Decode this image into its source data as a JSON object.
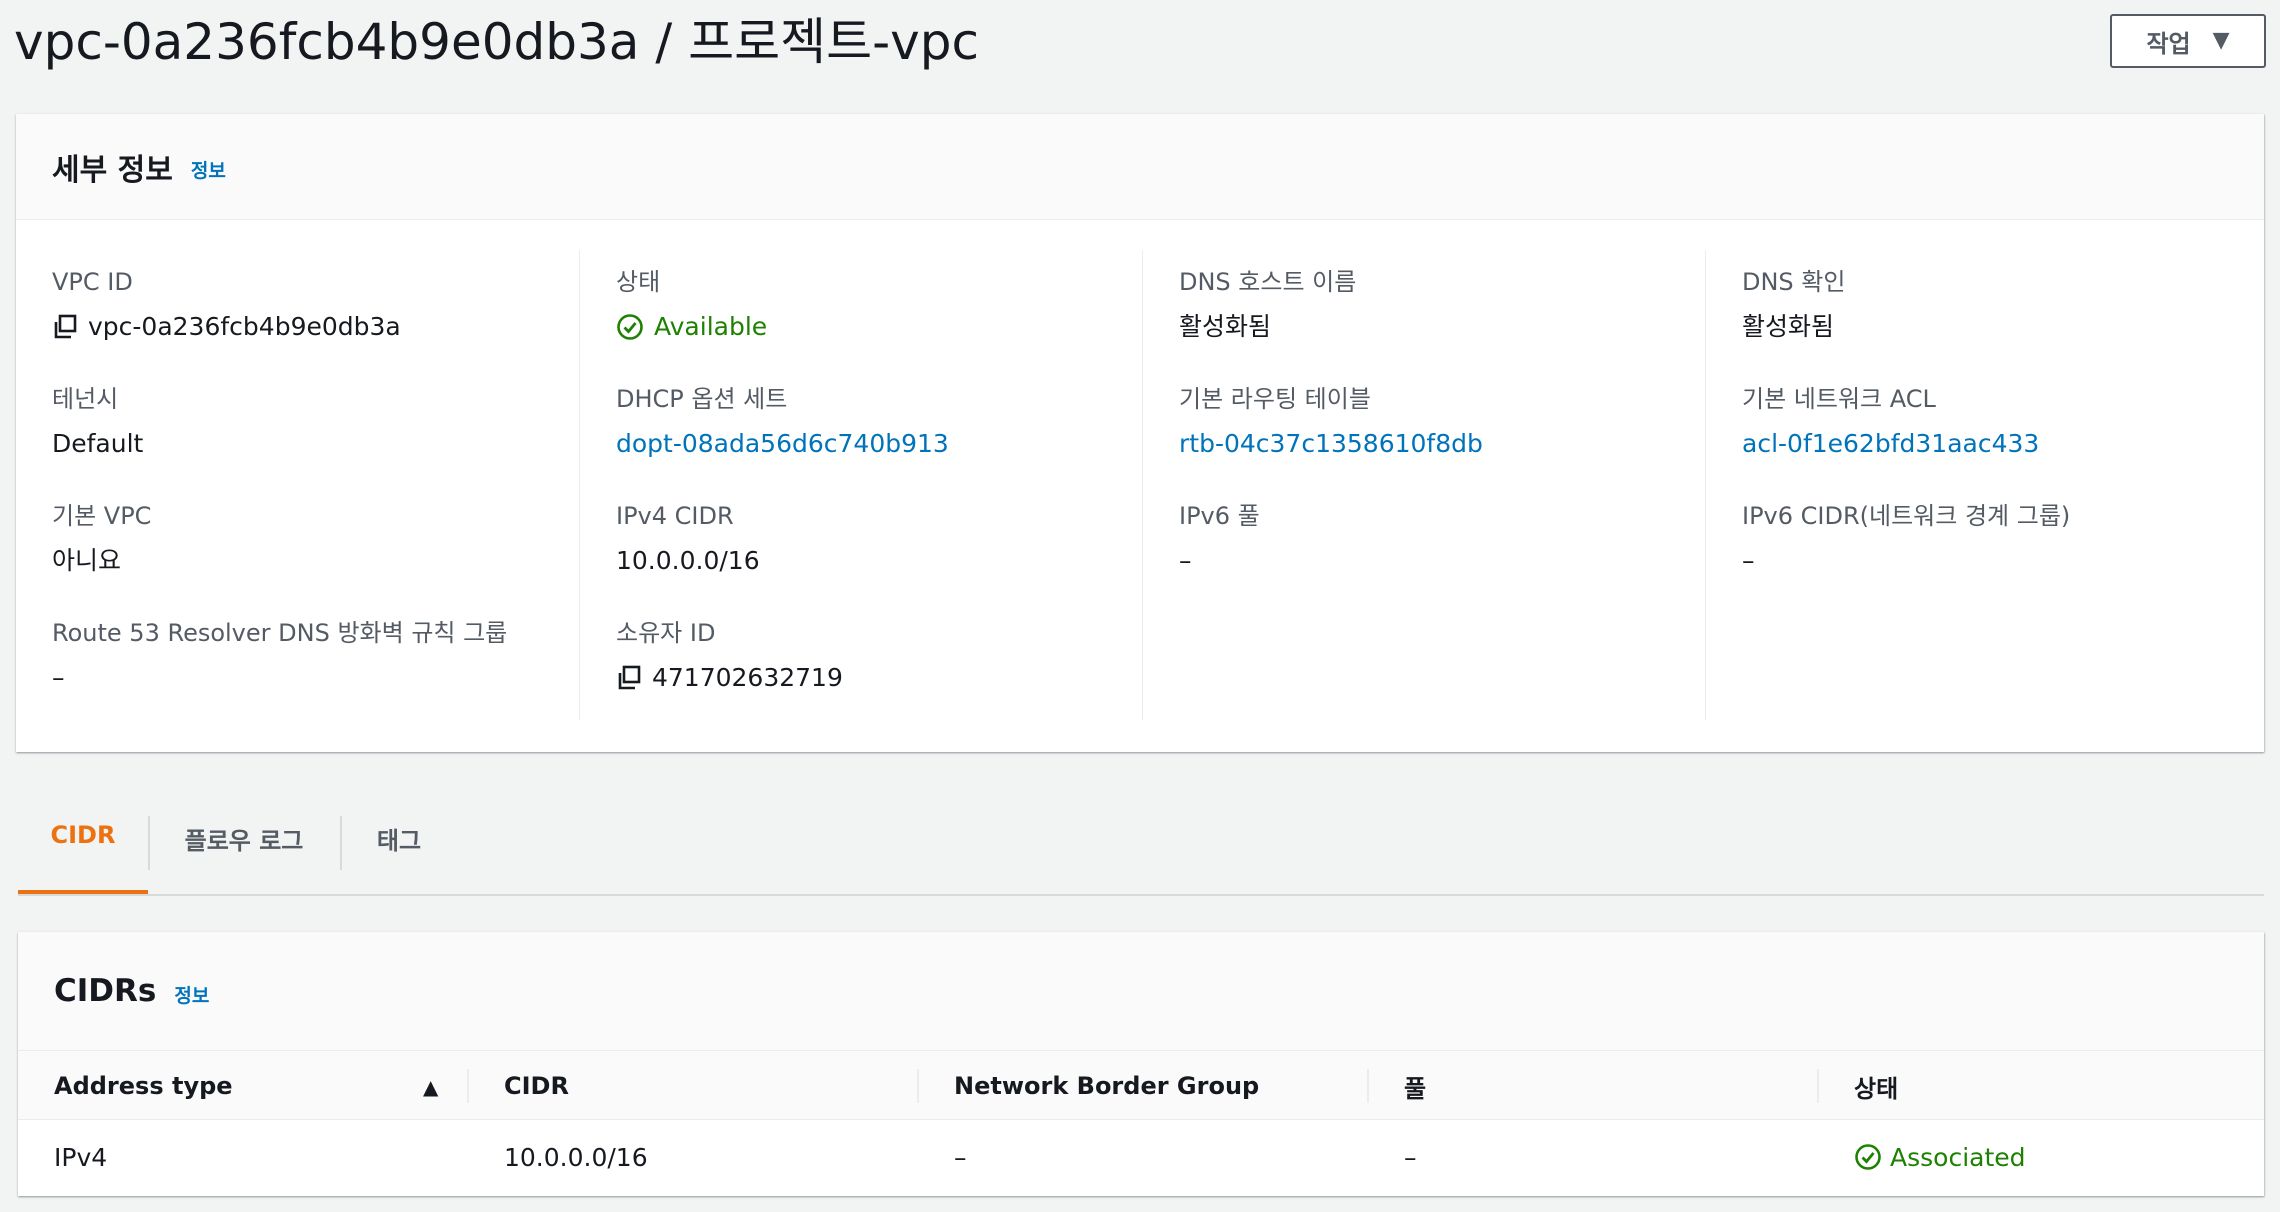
{
  "header": {
    "title": "vpc-0a236fcb4b9e0db3a / 프로젝트-vpc",
    "actions_label": "작업"
  },
  "details": {
    "title": "세부 정보",
    "info_label": "정보",
    "columns": [
      [
        {
          "label": "VPC ID",
          "value": "vpc-0a236fcb4b9e0db3a",
          "icon": "copy-icon"
        },
        {
          "label": "테넌시",
          "value": "Default"
        },
        {
          "label": "기본 VPC",
          "value": "아니요"
        },
        {
          "label": "Route 53 Resolver DNS 방화벽 규칙 그룹",
          "value": "–"
        }
      ],
      [
        {
          "label": "상태",
          "value": "Available",
          "icon": "check-circle-icon"
        },
        {
          "label": "DHCP 옵션 세트",
          "value": "dopt-08ada56d6c740b913"
        },
        {
          "label": "IPv4 CIDR",
          "value": "10.0.0.0/16"
        },
        {
          "label": "소유자 ID",
          "value": "471702632719",
          "icon": "copy-icon"
        }
      ],
      [
        {
          "label": "DNS 호스트 이름",
          "value": "활성화됨"
        },
        {
          "label": "기본 라우팅 테이블",
          "value": "rtb-04c37c1358610f8db"
        },
        {
          "label": "IPv6 풀",
          "value": "–"
        }
      ],
      [
        {
          "label": "DNS 확인",
          "value": "활성화됨"
        },
        {
          "label": "기본 네트워크 ACL",
          "value": "acl-0f1e62bfd31aac433"
        },
        {
          "label": "IPv6 CIDR(네트워크 경계 그룹)",
          "value": "–"
        }
      ]
    ]
  },
  "tabs": [
    {
      "label": "CIDR",
      "active": true
    },
    {
      "label": "플로우 로그",
      "active": false
    },
    {
      "label": "태그",
      "active": false
    }
  ],
  "cidrs": {
    "title": "CIDRs",
    "info_label": "정보",
    "columns": [
      "Address type",
      "CIDR",
      "Network Border Group",
      "풀",
      "상태"
    ],
    "rows": [
      [
        "IPv4",
        "10.0.0.0/16",
        "–",
        "–",
        "Associated"
      ]
    ]
  },
  "colors": {
    "link": "#0073bb",
    "success": "#1d8102",
    "active_tab": "#ec7211",
    "background": "#f2f3f3"
  }
}
